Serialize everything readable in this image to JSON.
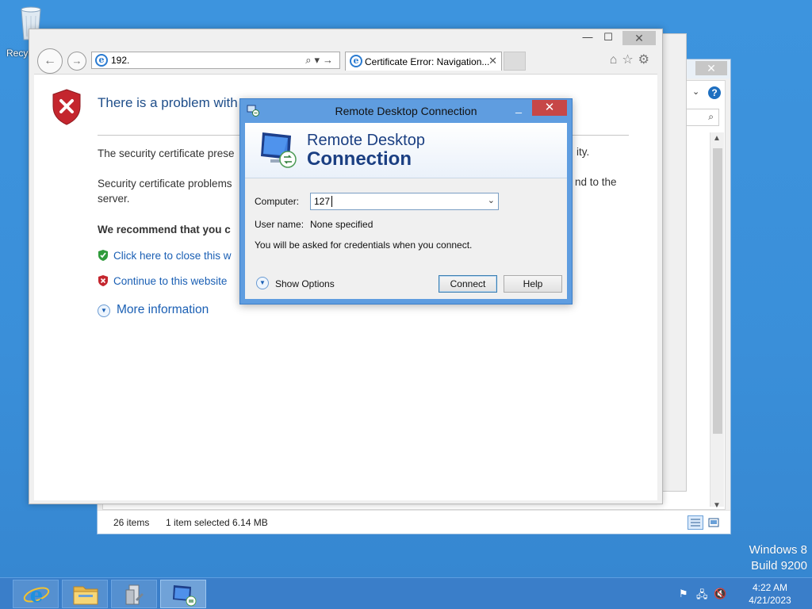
{
  "desktop": {
    "recycle_bin_label": "Recycle Bin",
    "watermark_line1": "Windows 8",
    "watermark_line2": "Build 9200"
  },
  "explorer": {
    "status_items": "26 items",
    "status_selected": "1 item selected  6.14 MB",
    "help_label": "?"
  },
  "ie": {
    "address_value": "192.",
    "tab_title": "Certificate Error: Navigation...",
    "content": {
      "title": "There is a problem with",
      "text1": "The security certificate prese",
      "text1_right": "ity.",
      "text2_line1": "Security certificate problems",
      "text2_line2": "server.",
      "text2_right": "nd to the",
      "recommend": "We recommend that you c",
      "link_close": "Click here to close this w",
      "link_continue": "Continue to this website",
      "more_info": "More information"
    }
  },
  "rdc": {
    "window_title": "Remote Desktop Connection",
    "banner_line1": "Remote Desktop",
    "banner_line2": "Connection",
    "computer_label": "Computer:",
    "computer_value": "127",
    "username_label": "User name:",
    "username_value": "None specified",
    "credentials_note": "You will be asked for credentials when you connect.",
    "show_options": "Show Options",
    "connect_button": "Connect",
    "help_button": "Help"
  },
  "taskbar": {
    "apps": [
      "internet-explorer",
      "file-explorer",
      "server-manager",
      "remote-desktop-connection"
    ],
    "active_app": "remote-desktop-connection",
    "clock_time": "4:22 AM",
    "clock_date": "4/21/2023"
  },
  "colors": {
    "desktop": "#3a8fd9",
    "taskbar": "#3a7ec9",
    "link": "#1a5fb4",
    "rdc_frame": "#5f9de0",
    "close_red": "#c74747"
  }
}
